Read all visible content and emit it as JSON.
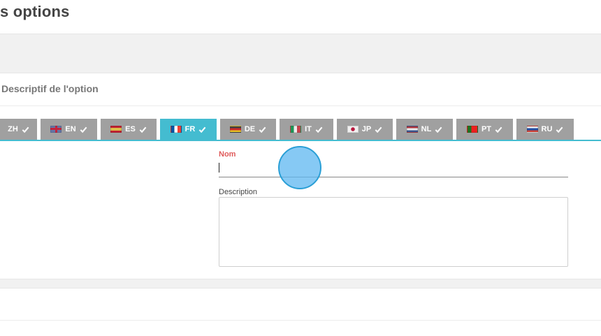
{
  "page": {
    "title": "s options"
  },
  "section": {
    "title": "Descriptif de l'option"
  },
  "language_tabs": [
    {
      "code": "ZH",
      "flag": "none",
      "checked": true,
      "active": false
    },
    {
      "code": "EN",
      "flag": "uk-flag-icon",
      "checked": true,
      "active": false
    },
    {
      "code": "ES",
      "flag": "spain-flag-icon",
      "checked": true,
      "active": false
    },
    {
      "code": "FR",
      "flag": "france-flag-icon",
      "checked": true,
      "active": true
    },
    {
      "code": "DE",
      "flag": "germany-flag-icon",
      "checked": true,
      "active": false
    },
    {
      "code": "IT",
      "flag": "italy-flag-icon",
      "checked": true,
      "active": false
    },
    {
      "code": "JP",
      "flag": "japan-flag-icon",
      "checked": true,
      "active": false
    },
    {
      "code": "NL",
      "flag": "netherlands-flag-icon",
      "checked": true,
      "active": false
    },
    {
      "code": "PT",
      "flag": "portugal-flag-icon",
      "checked": true,
      "active": false
    },
    {
      "code": "RU",
      "flag": "russia-flag-icon",
      "checked": true,
      "active": false
    }
  ],
  "form": {
    "name_label": "Nom",
    "name_value": "",
    "description_label": "Description",
    "description_value": ""
  },
  "colors": {
    "tab_inactive": "#a0a0a0",
    "tab_active": "#44bcd0",
    "required_label": "#e05b5b",
    "click_indicator": "#5eb7f0"
  }
}
